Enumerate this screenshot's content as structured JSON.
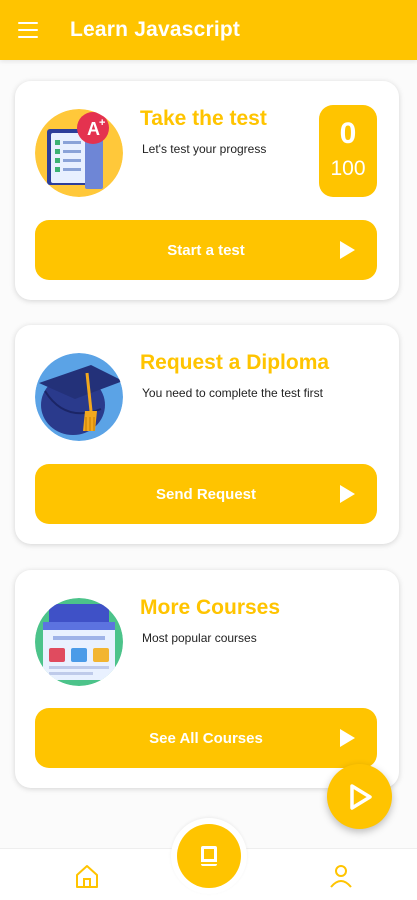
{
  "appbar": {
    "title": "Learn Javascript",
    "menu_icon": "hamburger-menu-icon"
  },
  "cards": {
    "test": {
      "title": "Take the test",
      "subtitle": "Let's test your progress",
      "score": {
        "value": "0",
        "total": "100"
      },
      "button": "Start a test",
      "icon": "exam-a-plus-icon"
    },
    "diploma": {
      "title": "Request a Diploma",
      "subtitle": "You need to complete the test first",
      "button": "Send Request",
      "icon": "graduation-cap-icon"
    },
    "courses": {
      "title": "More Courses",
      "subtitle": "Most popular courses",
      "button": "See All Courses",
      "icon": "browser-courses-icon"
    }
  },
  "bottom_nav": {
    "home": "home-icon",
    "center": "book-icon",
    "profile": "profile-icon"
  },
  "colors": {
    "accent": "#FFC400",
    "surface": "#FFFFFF",
    "text": "#222222"
  }
}
